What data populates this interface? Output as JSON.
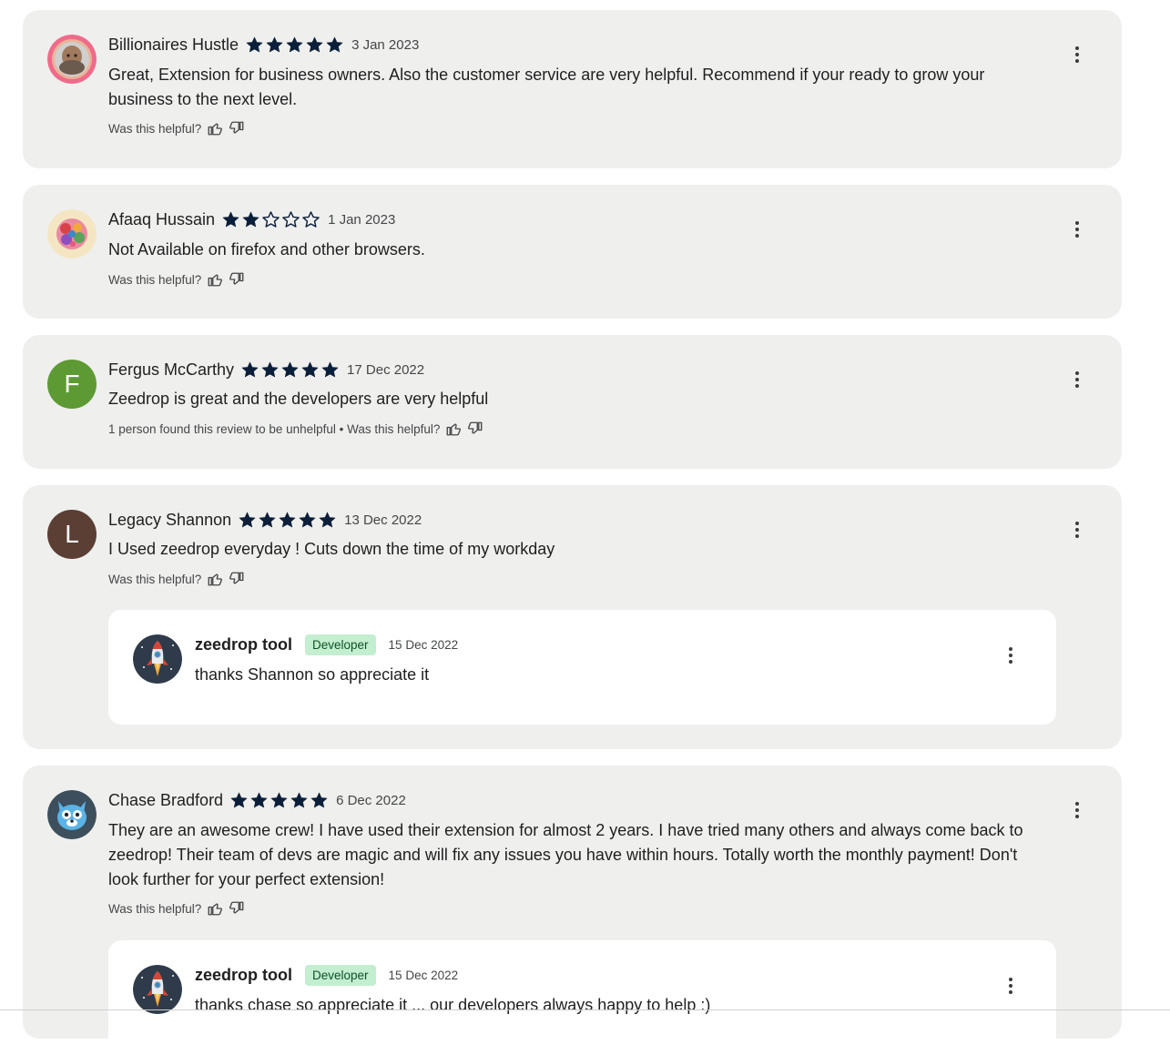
{
  "helpful_prompt": "Was this helpful?",
  "icons": {
    "thumbs_up": "thumbs-up-icon",
    "thumbs_down": "thumbs-down-icon",
    "more": "more-vertical-icon",
    "star": "star-icon"
  },
  "colors": {
    "card_bg": "#efefee",
    "star": "#0b1f3a",
    "badge_bg": "#c4eed0",
    "badge_text": "#0d5227"
  },
  "reviews": [
    {
      "name": "Billionaires Hustle",
      "rating": 5,
      "date": "3 Jan 2023",
      "text": "Great, Extension for business owners. Also the customer service are very helpful. Recommend if your ready to grow your business to the next level.",
      "helpful": "Was this helpful?"
    },
    {
      "name": "Afaaq Hussain",
      "rating": 2,
      "date": "1 Jan 2023",
      "text": "Not Available on firefox and other browsers.",
      "helpful": "Was this helpful?"
    },
    {
      "name": "Fergus McCarthy",
      "rating": 5,
      "date": "17 Dec 2022",
      "avatar_letter": "F",
      "avatar_color": "#5e9a34",
      "text": "Zeedrop is great and the developers are very helpful",
      "helpful": "1 person found this review to be unhelpful • Was this helpful?"
    },
    {
      "name": "Legacy Shannon",
      "rating": 5,
      "date": "13 Dec 2022",
      "avatar_letter": "L",
      "avatar_color": "#5b3e34",
      "text": "I Used zeedrop everyday ! Cuts down the time of my workday",
      "helpful": "Was this helpful?",
      "reply": {
        "name": "zeedrop tool",
        "badge": "Developer",
        "date": "15 Dec 2022",
        "text": "thanks Shannon so appreciate it"
      }
    },
    {
      "name": "Chase Bradford",
      "rating": 5,
      "date": "6 Dec 2022",
      "text": "They are an awesome crew! I have used their extension for almost 2 years. I have tried many others and always come back to zeedrop! Their team of devs are magic and will fix any issues you have within hours. Totally worth the monthly payment! Don't look further for your perfect extension!",
      "helpful": "Was this helpful?",
      "reply": {
        "name": "zeedrop tool",
        "badge": "Developer",
        "date": "15 Dec 2022",
        "text": "thanks chase so appreciate it ... our developers always happy to help :)"
      }
    }
  ]
}
